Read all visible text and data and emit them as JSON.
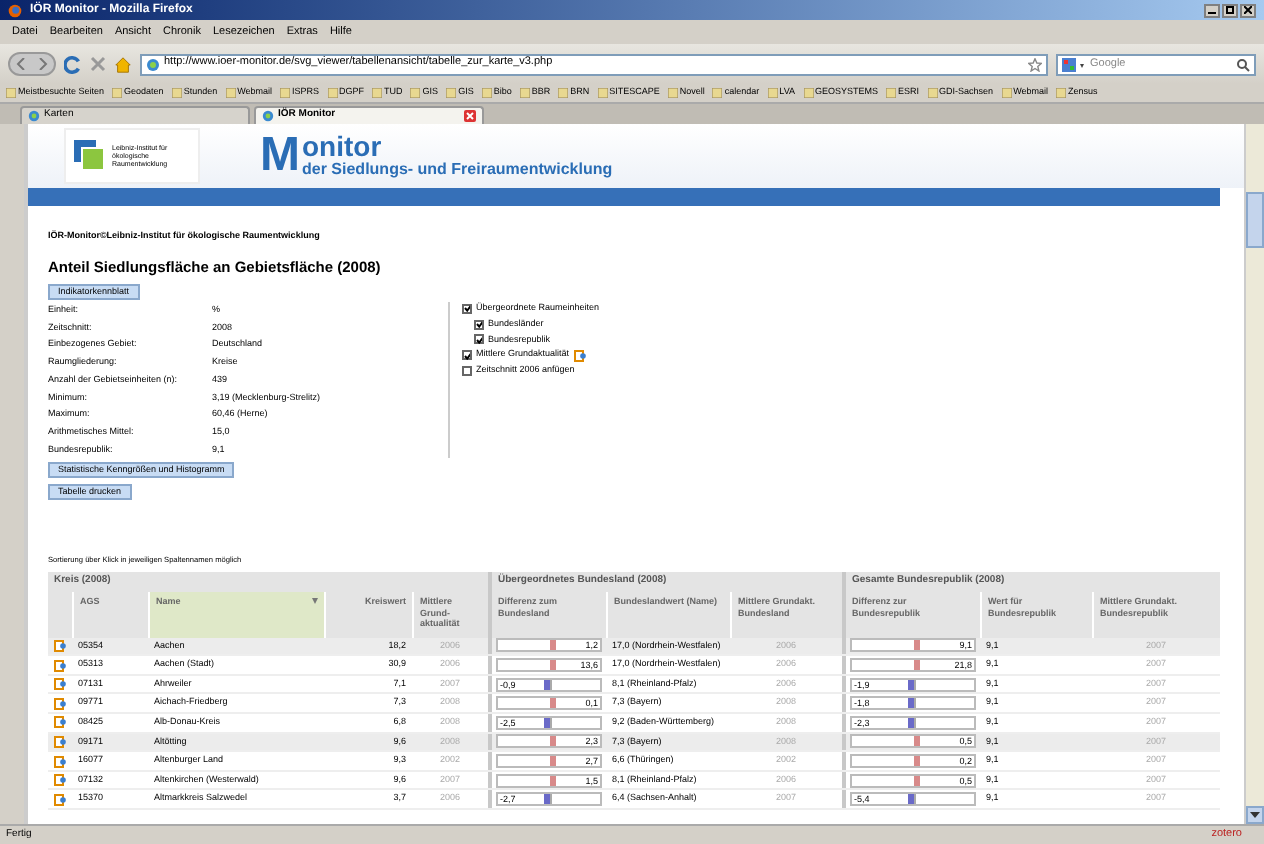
{
  "window": {
    "title": "IÖR Monitor - Mozilla Firefox"
  },
  "menu": [
    "Datei",
    "Bearbeiten",
    "Ansicht",
    "Chronik",
    "Lesezeichen",
    "Extras",
    "Hilfe"
  ],
  "address_bar": {
    "url": "http://www.ioer-monitor.de/svg_viewer/tabellenansicht/tabelle_zur_karte_v3.php"
  },
  "search": {
    "placeholder": "Google"
  },
  "bookmarks": [
    "Meistbesuchte Seiten",
    "Geodaten",
    "Stunden",
    "Webmail",
    "ISPRS",
    "DGPF",
    "TUD",
    "GIS",
    "GIS",
    "Bibo",
    "BBR",
    "BRN",
    "SITESCAPE",
    "Novell",
    "calendar",
    "LVA",
    "GEOSYSTEMS",
    "ESRI",
    "GDI-Sachsen",
    "Webmail",
    "Zensus"
  ],
  "tabs": [
    {
      "label": "Karten",
      "selected": false
    },
    {
      "label": "IÖR Monitor",
      "selected": true
    }
  ],
  "header": {
    "institute": "Leibniz-Institut für ökologische Raumentwicklung",
    "logo_initial": "M",
    "logo_rest": "onitor",
    "subtitle": "der Siedlungs- und Freiraumentwicklung"
  },
  "breadcrumb": "IÖR-Monitor©Leibniz-Institut für ökologische Raumentwicklung",
  "title": "Anteil Siedlungsfläche an Gebietsfläche (2008)",
  "sheet_button": "Indikatorkennblatt",
  "info": [
    {
      "label": "Einheit:",
      "value": "%"
    },
    {
      "label": "Zeitschnitt:",
      "value": "2008"
    },
    {
      "label": "Einbezogenes Gebiet:",
      "value": "Deutschland"
    },
    {
      "label": "Raumgliederung:",
      "value": "Kreise"
    },
    {
      "label": "Anzahl der Gebietseinheiten (n):",
      "value": "439"
    },
    {
      "label": "Minimum:",
      "value": "3,19 (Mecklenburg-Strelitz)"
    },
    {
      "label": "Maximum:",
      "value": "60,46 (Herne)"
    },
    {
      "label": "Arithmetisches Mittel:",
      "value": "15,0"
    },
    {
      "label": "Bundesrepublik:",
      "value": "9,1"
    }
  ],
  "options": [
    {
      "label": "Übergeordnete Raumeinheiten",
      "checked": true,
      "kind": "plain",
      "children": [
        {
          "label": "Bundesländer",
          "checked": true
        },
        {
          "label": "Bundesrepublik",
          "checked": true
        }
      ]
    },
    {
      "label": "Mittlere Grundaktualität",
      "checked": true,
      "kind": "info"
    },
    {
      "label": "Zeitschnitt 2006 anfügen",
      "checked": false,
      "kind": "plain"
    }
  ],
  "action_buttons": [
    "Statistische Kenngrößen und Histogramm",
    "Tabelle drucken"
  ],
  "sort_hint": "Sortierung über Klick in jeweiligen Spaltennamen möglich",
  "table": {
    "groups": [
      "Kreis (2008)",
      "Übergeordnetes Bundesland (2008)",
      "Gesamte Bundesrepublik (2008)"
    ],
    "columns": [
      {
        "label": "AGS",
        "sorted": false
      },
      {
        "label": "Name",
        "sorted": true
      },
      {
        "label": "Kreiswert",
        "sorted": false
      },
      {
        "label": "Mittlere Grund-aktualität",
        "sorted": false
      },
      {
        "label": "Differenz zum Bundesland",
        "sorted": false
      },
      {
        "label": "Bundeslandwert (Name)",
        "sorted": false
      },
      {
        "label": "Mittlere Grundakt. Bundesland",
        "sorted": false
      },
      {
        "label": "Differenz zur Bundesrepublik",
        "sorted": false
      },
      {
        "label": "Wert für Bundesrepublik",
        "sorted": false
      },
      {
        "label": "Mittlere Grundakt. Bundesrepublik",
        "sorted": false
      }
    ],
    "rows": [
      {
        "highlighted": true,
        "ags": "05354",
        "name": "Aachen",
        "value": "18,2",
        "year": "2006",
        "diff_land": {
          "text": "1,2",
          "kind": "positive"
        },
        "land": "17,0 (Nordrhein-Westfalen)",
        "land_year": "2006",
        "diff_bund": {
          "text": "9,1",
          "kind": "positive"
        },
        "bund": "9,1",
        "bund_year": "2007"
      },
      {
        "highlighted": false,
        "ags": "05313",
        "name": "Aachen (Stadt)",
        "value": "30,9",
        "year": "2006",
        "diff_land": {
          "text": "13,6",
          "kind": "positive"
        },
        "land": "17,0 (Nordrhein-Westfalen)",
        "land_year": "2006",
        "diff_bund": {
          "text": "21,8",
          "kind": "positive"
        },
        "bund": "9,1",
        "bund_year": "2007"
      },
      {
        "highlighted": false,
        "ags": "07131",
        "name": "Ahrweiler",
        "value": "7,1",
        "year": "2007",
        "diff_land": {
          "text": "-0,9",
          "kind": "negative"
        },
        "land": "8,1 (Rheinland-Pfalz)",
        "land_year": "2006",
        "diff_bund": {
          "text": "-1,9",
          "kind": "negative"
        },
        "bund": "9,1",
        "bund_year": "2007"
      },
      {
        "highlighted": false,
        "ags": "09771",
        "name": "Aichach-Friedberg",
        "value": "7,3",
        "year": "2008",
        "diff_land": {
          "text": "0,1",
          "kind": "positive"
        },
        "land": "7,3 (Bayern)",
        "land_year": "2008",
        "diff_bund": {
          "text": "-1,8",
          "kind": "negative"
        },
        "bund": "9,1",
        "bund_year": "2007"
      },
      {
        "highlighted": false,
        "ags": "08425",
        "name": "Alb-Donau-Kreis",
        "value": "6,8",
        "year": "2008",
        "diff_land": {
          "text": "-2,5",
          "kind": "negative"
        },
        "land": "9,2 (Baden-Württemberg)",
        "land_year": "2008",
        "diff_bund": {
          "text": "-2,3",
          "kind": "negative"
        },
        "bund": "9,1",
        "bund_year": "2007"
      },
      {
        "highlighted": true,
        "ags": "09171",
        "name": "Altötting",
        "value": "9,6",
        "year": "2008",
        "diff_land": {
          "text": "2,3",
          "kind": "positive"
        },
        "land": "7,3 (Bayern)",
        "land_year": "2008",
        "diff_bund": {
          "text": "0,5",
          "kind": "positive"
        },
        "bund": "9,1",
        "bund_year": "2007"
      },
      {
        "highlighted": false,
        "ags": "16077",
        "name": "Altenburger Land",
        "value": "9,3",
        "year": "2002",
        "diff_land": {
          "text": "2,7",
          "kind": "positive"
        },
        "land": "6,6 (Thüringen)",
        "land_year": "2002",
        "diff_bund": {
          "text": "0,2",
          "kind": "positive"
        },
        "bund": "9,1",
        "bund_year": "2007"
      },
      {
        "highlighted": false,
        "ags": "07132",
        "name": "Altenkirchen (Westerwald)",
        "value": "9,6",
        "year": "2007",
        "diff_land": {
          "text": "1,5",
          "kind": "positive"
        },
        "land": "8,1 (Rheinland-Pfalz)",
        "land_year": "2006",
        "diff_bund": {
          "text": "0,5",
          "kind": "positive"
        },
        "bund": "9,1",
        "bund_year": "2007"
      },
      {
        "highlighted": false,
        "ags": "15370",
        "name": "Altmarkkreis Salzwedel",
        "value": "3,7",
        "year": "2006",
        "diff_land": {
          "text": "-2,7",
          "kind": "negative"
        },
        "land": "6,4 (Sachsen-Anhalt)",
        "land_year": "2007",
        "diff_bund": {
          "text": "-5,4",
          "kind": "negative"
        },
        "bund": "9,1",
        "bund_year": "2007"
      }
    ]
  },
  "status_bar": {
    "text": "Fertig",
    "addon": "zotero"
  }
}
